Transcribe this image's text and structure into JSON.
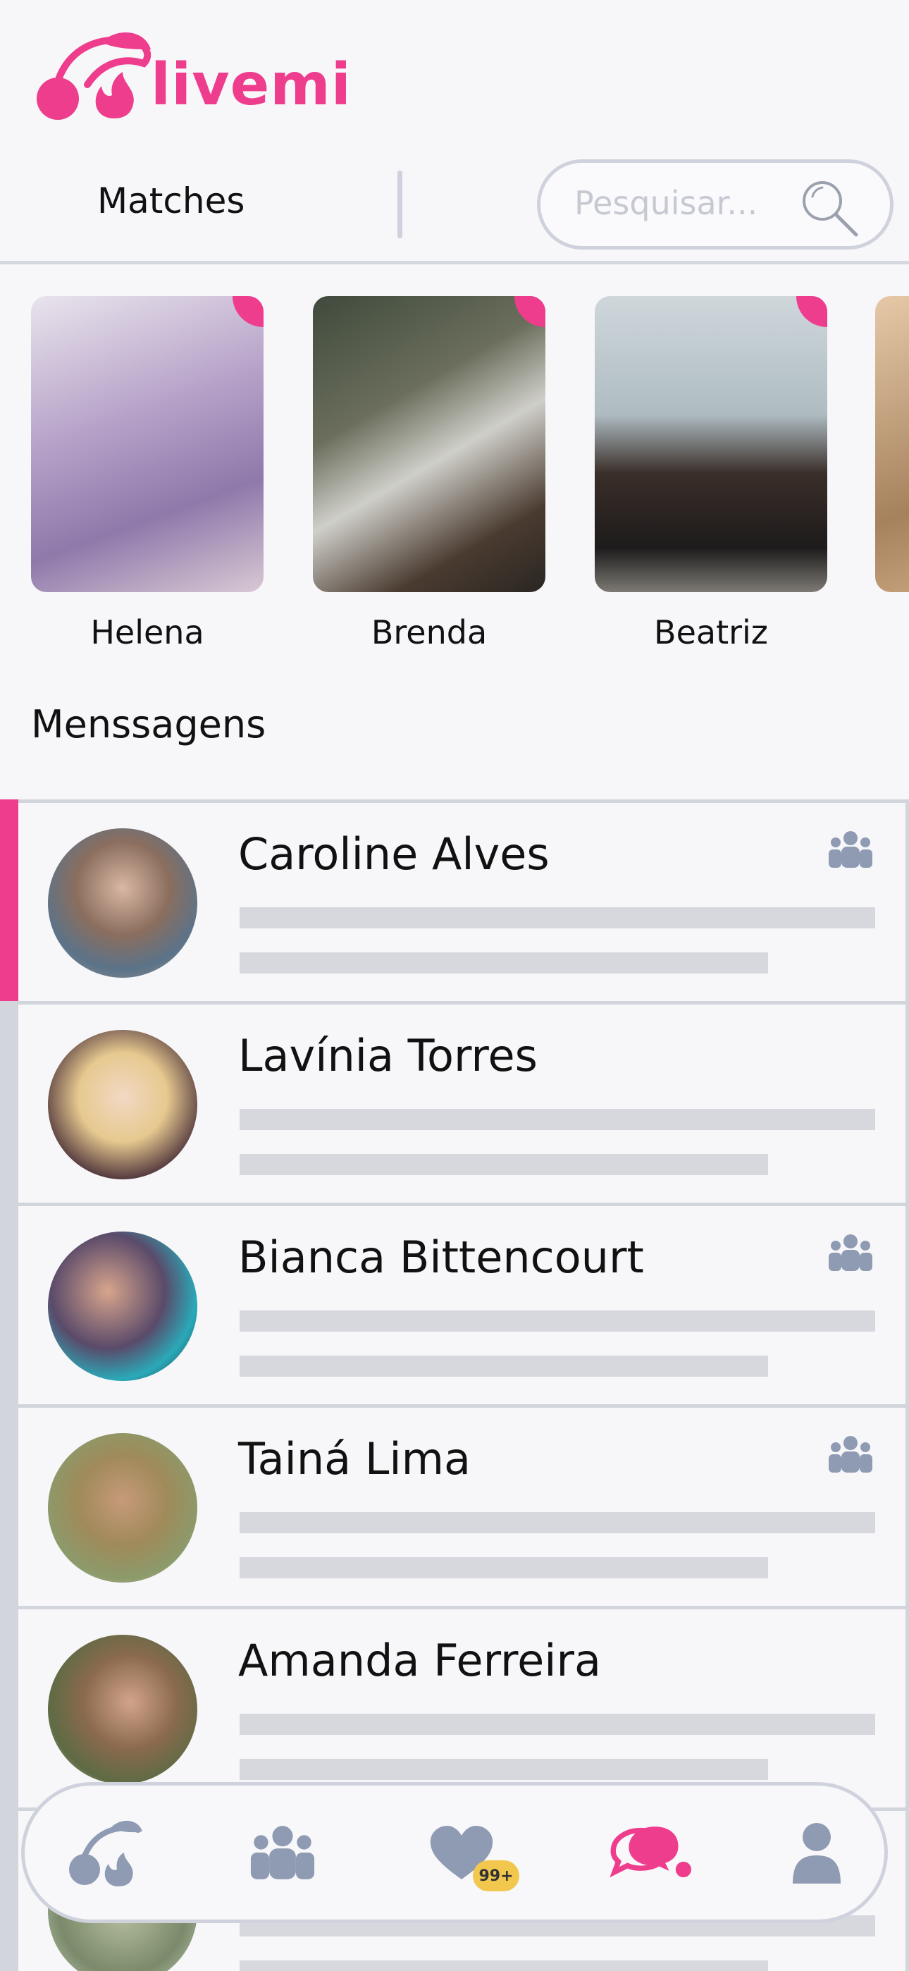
{
  "app": {
    "name": "livemi",
    "brand_color": "#ee3d8d"
  },
  "matches": {
    "title": "Matches",
    "search_placeholder": "Pesquisar...",
    "cards": [
      {
        "name": "Helena"
      },
      {
        "name": "Brenda"
      },
      {
        "name": "Beatriz"
      }
    ]
  },
  "messages": {
    "title": "Menssagens",
    "items": [
      {
        "name": "Caroline Alves",
        "active": true,
        "group": true
      },
      {
        "name": "Lavínia Torres",
        "active": false,
        "group": false
      },
      {
        "name": "Bianca Bittencourt",
        "active": false,
        "group": true
      },
      {
        "name": "Tainá Lima",
        "active": false,
        "group": true
      },
      {
        "name": "Amanda Ferreira",
        "active": false,
        "group": false
      }
    ]
  },
  "nav": {
    "items": [
      {
        "icon": "cherry-icon"
      },
      {
        "icon": "group-icon"
      },
      {
        "icon": "heart-icon",
        "badge": "99+"
      },
      {
        "icon": "chat-icon",
        "active": true
      },
      {
        "icon": "profile-icon"
      }
    ]
  },
  "colors": {
    "muted_icon": "#8f9bb3",
    "skeleton": "#d6d8de",
    "badge": "#f2c74d"
  }
}
